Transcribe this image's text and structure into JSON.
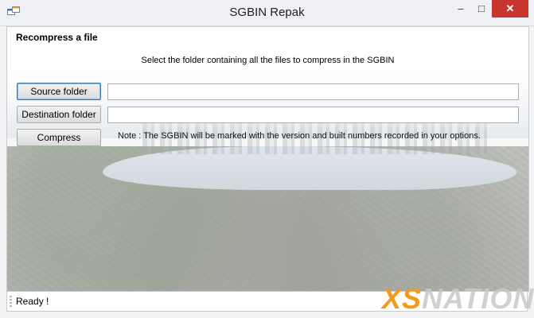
{
  "window": {
    "title": "SGBIN Repak",
    "controls": {
      "minimize": "–",
      "maximize": "□",
      "close": "✕"
    }
  },
  "panel": {
    "section_title": "Recompress a file",
    "instruction": "Select the folder containing all the files to compress in the SGBIN",
    "source_button": "Source folder",
    "source_path": "",
    "destination_button": "Destination folder",
    "destination_path": "",
    "compress_button": "Compress",
    "note": "Note : The SGBIN will be marked with the version and built numbers recorded in your options."
  },
  "status": {
    "text": "Ready !"
  },
  "watermark": {
    "xs": "XS",
    "nation": "NATION"
  },
  "colors": {
    "close_button": "#c7372f",
    "watermark_orange": "#f39a1c",
    "focus_border": "#3c7fb1"
  },
  "icons": {
    "app": "app-window-icon"
  }
}
